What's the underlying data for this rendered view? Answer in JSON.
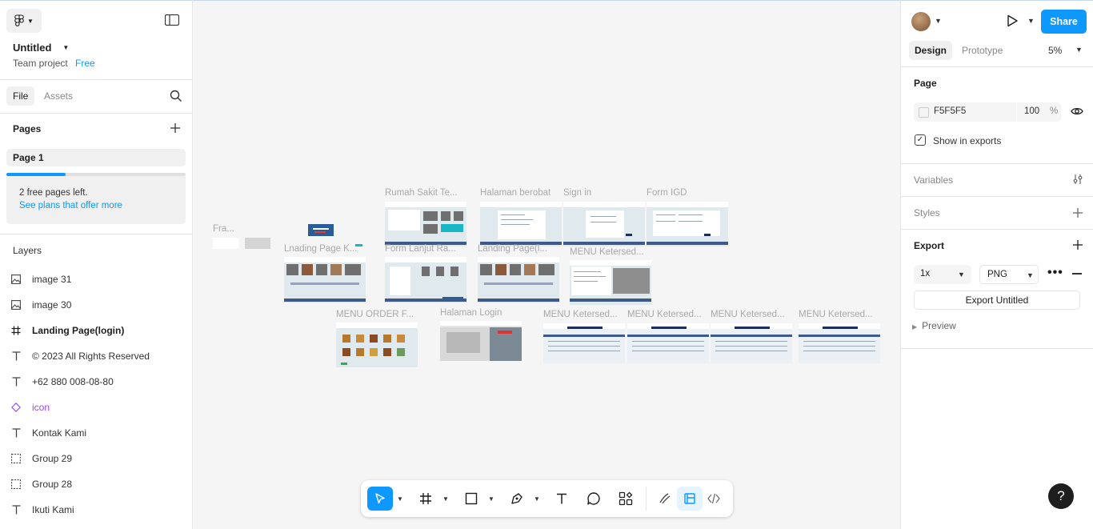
{
  "app": {
    "file_title": "Untitled",
    "team_label": "Team project",
    "plan_badge": "Free"
  },
  "left_tabs": {
    "file": "File",
    "assets": "Assets"
  },
  "pages": {
    "title": "Pages",
    "items": [
      {
        "label": "Page 1"
      }
    ],
    "notice_text": "2 free pages left.",
    "notice_link": "See plans that offer more",
    "usage_fraction": 0.33
  },
  "layers": {
    "title": "Layers",
    "items": [
      {
        "type": "image",
        "icon": "image-icon",
        "label": "image 31"
      },
      {
        "type": "image",
        "icon": "image-icon",
        "label": "image 30"
      },
      {
        "type": "frame",
        "icon": "frame-icon",
        "label": "Landing Page(login)"
      },
      {
        "type": "text",
        "icon": "text-icon",
        "label": "© 2023 All Rights Reserved"
      },
      {
        "type": "text",
        "icon": "text-icon",
        "label": "+62 880 008-08-80"
      },
      {
        "type": "component",
        "icon": "component-icon",
        "label": "icon"
      },
      {
        "type": "text",
        "icon": "text-icon",
        "label": "Kontak Kami"
      },
      {
        "type": "group",
        "icon": "group-icon",
        "label": "Group 29"
      },
      {
        "type": "group",
        "icon": "group-icon",
        "label": "Group 28"
      },
      {
        "type": "text",
        "icon": "text-icon",
        "label": "Ikuti Kami"
      }
    ]
  },
  "right_panel": {
    "share_label": "Share",
    "tabs": {
      "design": "Design",
      "prototype": "Prototype"
    },
    "zoom": "5%",
    "page_section": {
      "title": "Page",
      "background_hex": "F5F5F5",
      "background_color": "#F5F5F5",
      "opacity": "100",
      "opacity_unit": "%",
      "show_in_exports_label": "Show in exports",
      "show_in_exports_checked": true
    },
    "variables_label": "Variables",
    "styles_label": "Styles",
    "export": {
      "title": "Export",
      "scale": "1x",
      "format": "PNG",
      "button_label": "Export Untitled",
      "preview_label": "Preview"
    },
    "help_label": "?"
  },
  "canvas": {
    "frames": [
      {
        "label": "Fra..."
      },
      {
        "label": "Rumah Sakit Te..."
      },
      {
        "label": "Halaman berobat"
      },
      {
        "label": "Sign in"
      },
      {
        "label": "Form IGD"
      },
      {
        "label": "Lnading Page K..."
      },
      {
        "label": "Form Lanjut Ra..."
      },
      {
        "label": "Landing Page(l..."
      },
      {
        "label": "MENU Ketersed..."
      },
      {
        "label": "MENU ORDER F..."
      },
      {
        "label": "Halaman Login"
      },
      {
        "label": "MENU Ketersed..."
      },
      {
        "label": "MENU Ketersed..."
      },
      {
        "label": "MENU Ketersed..."
      },
      {
        "label": "MENU Ketersed..."
      }
    ]
  },
  "toolbar": {
    "tools": [
      "move-tool",
      "frame-tool",
      "shape-tool",
      "pen-tool",
      "text-tool",
      "comment-tool",
      "actions-tool",
      "draw-mode",
      "design-mode",
      "dev-mode"
    ]
  },
  "colors": {
    "accent": "#0d99ff",
    "component": "#9747ff",
    "canvas_bg": "#f5f5f5",
    "help_bg": "#1e1e1e"
  }
}
